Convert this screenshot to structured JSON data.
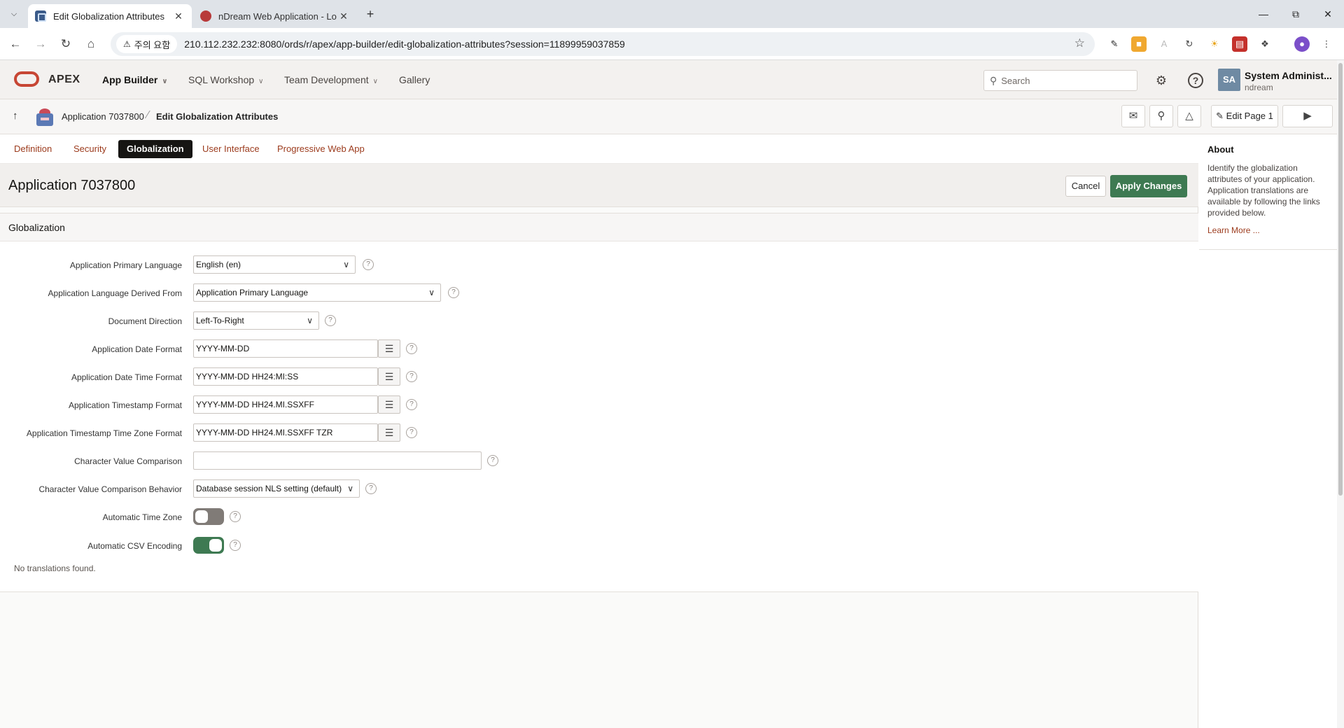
{
  "browser": {
    "tabs": [
      {
        "title": "Edit Globalization Attributes",
        "active": true
      },
      {
        "title": "nDream Web Application - Lo",
        "active": false
      }
    ],
    "new_tab": "+",
    "security_warning": "주의 요함",
    "url": "210.112.232.232:8080/ords/r/apex/app-builder/edit-globalization-attributes?session=11899959037859"
  },
  "apex_header": {
    "product": "APEX",
    "menus": [
      "App Builder",
      "SQL Workshop",
      "Team Development",
      "Gallery"
    ],
    "search_placeholder": "Search",
    "user_initials": "SA",
    "user_name": "System Administ...",
    "user_workspace": "ndream"
  },
  "breadcrumb": {
    "application": "Application 7037800",
    "current": "Edit Globalization Attributes",
    "edit_page": "Edit Page 1"
  },
  "tabs": {
    "items": [
      "Definition",
      "Security",
      "Globalization",
      "User Interface",
      "Progressive Web App"
    ],
    "active": "Globalization"
  },
  "page": {
    "title": "Application 7037800",
    "cancel": "Cancel",
    "apply": "Apply Changes"
  },
  "region": {
    "title": "Globalization",
    "fields": {
      "primary_language": {
        "label": "Application Primary Language",
        "value": "English (en)"
      },
      "language_derived": {
        "label": "Application Language Derived From",
        "value": "Application Primary Language"
      },
      "document_direction": {
        "label": "Document Direction",
        "value": "Left-To-Right"
      },
      "date_format": {
        "label": "Application Date Format",
        "value": "YYYY-MM-DD"
      },
      "date_time_format": {
        "label": "Application Date Time Format",
        "value": "YYYY-MM-DD HH24:MI:SS"
      },
      "timestamp_format": {
        "label": "Application Timestamp Format",
        "value": "YYYY-MM-DD HH24.MI.SSXFF"
      },
      "timestamp_tz_format": {
        "label": "Application Timestamp Time Zone Format",
        "value": "YYYY-MM-DD HH24.MI.SSXFF TZR"
      },
      "char_comparison": {
        "label": "Character Value Comparison",
        "value": ""
      },
      "char_comparison_behavior": {
        "label": "Character Value Comparison Behavior",
        "value": "Database session NLS setting (default)"
      },
      "auto_time_zone": {
        "label": "Automatic Time Zone",
        "on": false
      },
      "auto_csv_encoding": {
        "label": "Automatic CSV Encoding",
        "on": true
      }
    },
    "no_translations": "No translations found."
  },
  "about": {
    "title": "About",
    "text": "Identify the globalization attributes of your application. Application translations are available by following the links provided below.",
    "link": "Learn More ..."
  },
  "colors": {
    "accent": "#3e7a52",
    "link": "#9c3b1d",
    "oracle_red": "#c74634"
  }
}
